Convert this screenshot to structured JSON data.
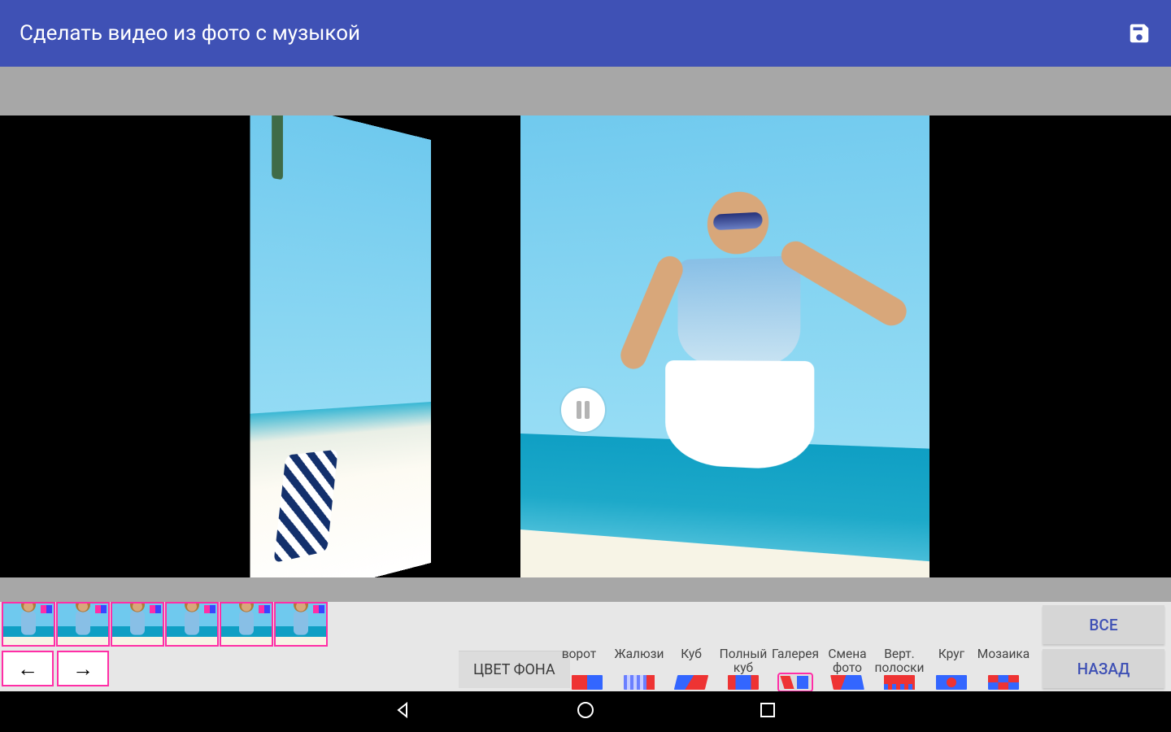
{
  "appbar": {
    "title": "Сделать видео из фото с музыкой"
  },
  "controls": {
    "arrow_left": "←",
    "arrow_right": "→",
    "bgcolor_label": "ЦВЕТ ФОНА",
    "all_label": "ВСЕ",
    "back_label": "НАЗАД"
  },
  "effects": [
    {
      "id": "rotate",
      "label": "ворот",
      "icon": "ico-grad-rb",
      "selected": false,
      "clipped": true
    },
    {
      "id": "blinds",
      "label": "Жалюзи",
      "icon": "ico-stripes",
      "selected": false
    },
    {
      "id": "cube",
      "label": "Куб",
      "icon": "ico-cube",
      "selected": false
    },
    {
      "id": "fullcube",
      "label": "Полный\nкуб",
      "icon": "ico-full",
      "selected": false
    },
    {
      "id": "gallery",
      "label": "Галерея",
      "icon": "ico-gallery",
      "selected": true
    },
    {
      "id": "swap",
      "label": "Смена\nфото",
      "icon": "ico-swap",
      "selected": false
    },
    {
      "id": "vstripes",
      "label": "Верт.\nполоски",
      "icon": "ico-vstr",
      "selected": false
    },
    {
      "id": "circle",
      "label": "Круг",
      "icon": "ico-circle",
      "selected": false
    },
    {
      "id": "mosaic",
      "label": "Мозаика",
      "icon": "ico-mosaic",
      "selected": false
    }
  ],
  "thumbnails": [
    0,
    1,
    2,
    3,
    4,
    5
  ]
}
